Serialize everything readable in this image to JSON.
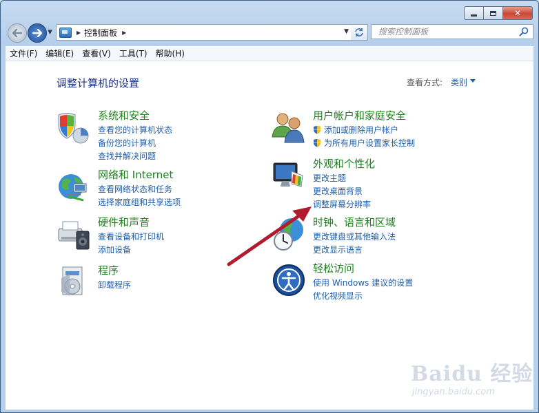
{
  "window": {
    "caption_icons": [
      "minimize-icon",
      "maximize-icon",
      "close-icon"
    ]
  },
  "navigation": {
    "breadcrumb": "控制面板",
    "search_placeholder": "搜索控制面板"
  },
  "menu": [
    "文件(F)",
    "编辑(E)",
    "查看(V)",
    "工具(T)",
    "帮助(H)"
  ],
  "content": {
    "title": "调整计算机的设置",
    "view_by_label": "查看方式:",
    "view_by_value": "类别"
  },
  "categories": [
    {
      "heading": "系统和安全",
      "icon": "shield-pie-icon",
      "links": [
        "查看您的计算机状态",
        "备份您的计算机",
        "查找并解决问题"
      ]
    },
    {
      "heading": "网络和 Internet",
      "icon": "globe-network-icon",
      "links": [
        "查看网络状态和任务",
        "选择家庭组和共享选项"
      ]
    },
    {
      "heading": "硬件和声音",
      "icon": "printer-speaker-icon",
      "links": [
        "查看设备和打印机",
        "添加设备"
      ]
    },
    {
      "heading": "程序",
      "icon": "programs-icon",
      "links": [
        "卸载程序"
      ]
    },
    {
      "heading": "用户帐户和家庭安全",
      "icon": "users-icon",
      "links": [
        "添加或删除用户帐户",
        "为所有用户设置家长控制"
      ]
    },
    {
      "heading": "外观和个性化",
      "icon": "monitor-palette-icon",
      "links": [
        "更改主题",
        "更改桌面背景",
        "调整屏幕分辨率"
      ]
    },
    {
      "heading": "时钟、语言和区域",
      "icon": "clock-globe-icon",
      "links": [
        "更改键盘或其他输入法",
        "更改显示语言"
      ]
    },
    {
      "heading": "轻松访问",
      "icon": "ease-of-access-icon",
      "links": [
        "使用 Windows 建议的设置",
        "优化视频显示"
      ]
    }
  ],
  "annotation": {
    "arrow_color": "#b01c2e"
  },
  "watermark": {
    "logo": "Baidu 经验",
    "url": "jingyan.baidu.com"
  }
}
